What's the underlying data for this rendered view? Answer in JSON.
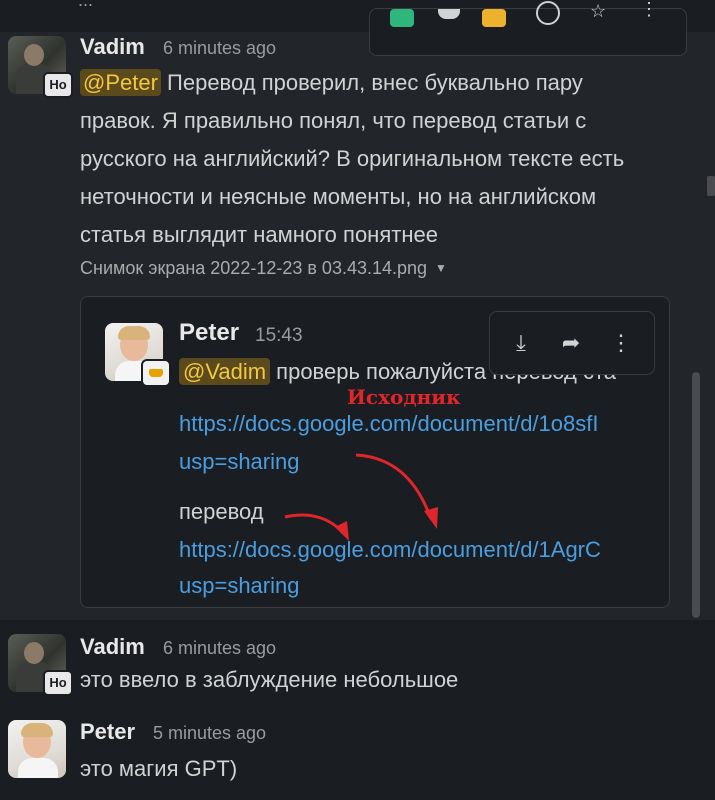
{
  "top_cut_text": "...",
  "messages": [
    {
      "author": "Vadim",
      "time": "6 minutes ago",
      "status": "Но",
      "mention": "@Peter",
      "text": " Перевод проверил, внес буквально пару правок. Я правильно понял, что перевод статьи с русского на английский? В оригинальном тексте есть неточности и неясные моменты, но на английском статья выглядит намного понятнее",
      "attachment": "Снимок экрана 2022-12-23 в 03.43.14.png"
    },
    {
      "author": "Vadim",
      "time": "6 minutes ago",
      "status": "Но",
      "text": "это ввело в заблуждение небольшое"
    },
    {
      "author": "Peter",
      "time": "5 minutes ago",
      "text": "это магия GPT)"
    }
  ],
  "preview": {
    "author": "Peter",
    "time": "15:43",
    "mention": "@Vadim",
    "line1_text": " проверь пожалуйста перевод ста",
    "link1": "https://docs.google.com/document/d/1o8sfI",
    "link1_tail": "usp=sharing",
    "translation_label": "перевод",
    "link2": "https://docs.google.com/document/d/1AgrC",
    "link2_tail": "usp=sharing",
    "annotation": "Исходник"
  },
  "colors": {
    "link": "#4a9ee0",
    "mention_bg": "#5b4a1c",
    "mention_fg": "#f2c744",
    "annotation": "#e0262b"
  },
  "icons": [
    "download-icon",
    "share-icon",
    "more-vertical-icon"
  ]
}
